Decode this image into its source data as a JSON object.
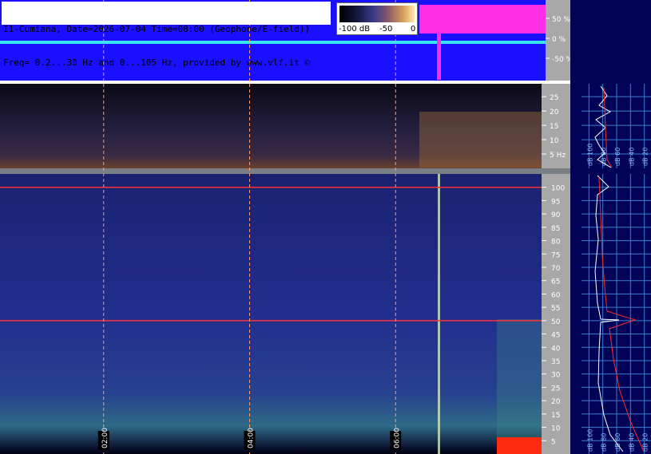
{
  "header": {
    "line1": "I1-Cumiana, Date=2026-07-04 Time=08:00 (Geophone/E-field))",
    "line2": "Freq= 0.2...30 Hz and 0...105 Hz, provided by www.vlf.it ©"
  },
  "colorbar": {
    "labels": [
      "-100 dB",
      "-50",
      "0"
    ]
  },
  "colors": {
    "waveform_bg": "#1a10ff",
    "waveform_magenta": "#ff2ee6",
    "waveform_cyan": "#39e6f0",
    "spectro_dark": "#120f1e",
    "spectro_blue": "#1e2a84",
    "axis_gray": "#a8a8a8",
    "side_bg": "#020257",
    "marker_red": "#ff3030",
    "time_line": "#ff9a6a"
  },
  "chart_data": [
    {
      "type": "line",
      "panel": "waveform",
      "y_tick_labels": [
        "50 %",
        "0 %",
        "-50 %"
      ],
      "y_ticks": [
        50,
        0,
        -50
      ],
      "ylim": [
        -100,
        100
      ]
    },
    {
      "type": "heatmap",
      "panel": "spectrogram-low",
      "y_tick_labels": [
        "25",
        "20",
        "15",
        "10",
        "5 Hz"
      ],
      "y_ticks": [
        25,
        20,
        15,
        10,
        5
      ],
      "ylim": [
        0.2,
        30
      ],
      "colorbar": {
        "min": -100,
        "max": 0,
        "unit": "dB"
      }
    },
    {
      "type": "heatmap",
      "panel": "spectrogram-high",
      "y_tick_labels": [
        "100",
        "95",
        "90",
        "85",
        "80",
        "75",
        "70",
        "65",
        "60",
        "55",
        "50",
        "45",
        "40",
        "35",
        "30",
        "25",
        "20",
        "15",
        "10",
        "5"
      ],
      "y_ticks": [
        100,
        95,
        90,
        85,
        80,
        75,
        70,
        65,
        60,
        55,
        50,
        45,
        40,
        35,
        30,
        25,
        20,
        15,
        10,
        5
      ],
      "ylim": [
        0,
        105
      ],
      "x_time_labels": [
        "02:00",
        "04:00",
        "06:00"
      ],
      "x_time_hours": [
        2,
        4,
        6
      ],
      "xlim_hours": [
        0.58,
        8.0
      ],
      "marker_lines_hz": [
        100,
        50
      ]
    },
    {
      "type": "line",
      "panel": "average-spectrum-low",
      "x_tick_labels": [
        "dB 100",
        "dB 80",
        "dB 60",
        "dB 40",
        "dB 20"
      ],
      "x_ticks_db": [
        -100,
        -80,
        -60,
        -40,
        -20
      ]
    },
    {
      "type": "line",
      "panel": "average-spectrum-high",
      "x_tick_labels": [
        "dB 100",
        "dB 80",
        "dB 60",
        "dB 40",
        "dB 20"
      ],
      "x_ticks_db": [
        -100,
        -80,
        -60,
        -40,
        -20
      ],
      "peaks_hz": [
        100,
        50
      ]
    }
  ]
}
